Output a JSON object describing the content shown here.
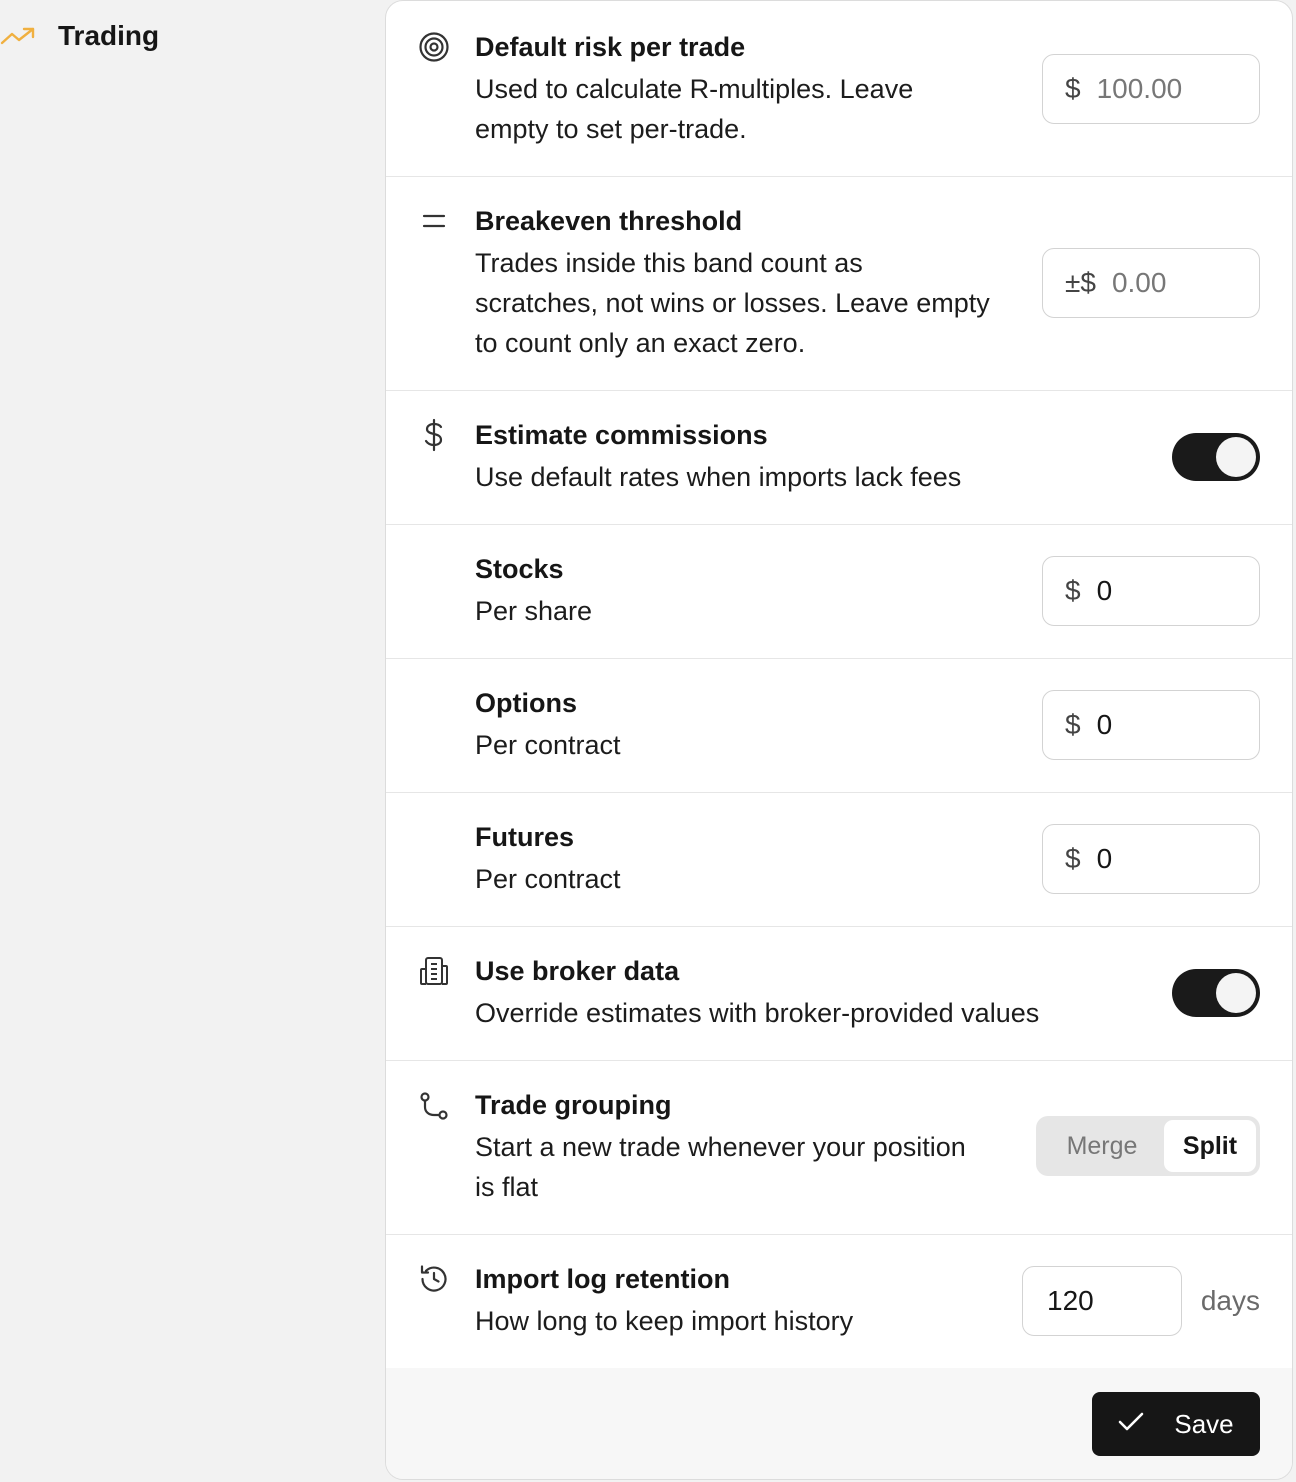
{
  "sidebar": {
    "items": [
      {
        "label": "Trading",
        "icon": "trending-up-icon",
        "icon_color": "#f0b040"
      }
    ]
  },
  "settings": {
    "risk": {
      "title": "Default risk per trade",
      "desc": "Used to calculate R-multiples. Leave empty to set per-trade.",
      "prefix": "$",
      "placeholder": "100.00",
      "icon": "target-icon"
    },
    "breakeven": {
      "title": "Breakeven threshold",
      "desc": "Trades inside this band count as scratches, not wins or losses. Leave empty to count only an exact zero.",
      "prefix": "±$",
      "placeholder": "0.00",
      "icon": "equals-icon"
    },
    "commissions": {
      "title": "Estimate commissions",
      "desc": "Use default rates when imports lack fees",
      "enabled": true,
      "icon": "dollar-icon"
    },
    "stocks": {
      "title": "Stocks",
      "desc": "Per share",
      "prefix": "$",
      "value": "0"
    },
    "options": {
      "title": "Options",
      "desc": "Per contract",
      "prefix": "$",
      "value": "0"
    },
    "futures": {
      "title": "Futures",
      "desc": "Per contract",
      "prefix": "$",
      "value": "0"
    },
    "broker": {
      "title": "Use broker data",
      "desc": "Override estimates with broker-provided values",
      "enabled": true,
      "icon": "building-icon"
    },
    "grouping": {
      "title": "Trade grouping",
      "desc": "Start a new trade whenever your position is flat",
      "options": [
        "Merge",
        "Split"
      ],
      "selected": "Split",
      "icon": "git-branch-icon"
    },
    "retention": {
      "title": "Import log retention",
      "desc": "How long to keep import history",
      "value": "120",
      "unit": "days",
      "icon": "history-icon"
    }
  },
  "footer": {
    "save_label": "Save",
    "save_icon": "check-icon"
  },
  "colors": {
    "toggle_on": "#1a1a1a",
    "accent": "#f0b040",
    "button_bg": "#161616"
  }
}
